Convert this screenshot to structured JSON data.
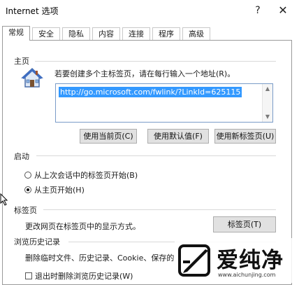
{
  "window": {
    "title": "Internet 选项",
    "help_glyph": "?",
    "close_glyph": "✕"
  },
  "tabs": [
    {
      "label": "常规",
      "active": true
    },
    {
      "label": "安全",
      "active": false
    },
    {
      "label": "隐私",
      "active": false
    },
    {
      "label": "内容",
      "active": false
    },
    {
      "label": "连接",
      "active": false
    },
    {
      "label": "程序",
      "active": false
    },
    {
      "label": "高级",
      "active": false
    }
  ],
  "homepage": {
    "group_label": "主页",
    "icon": "home-icon",
    "hint": "若要创建多个主标签页，请在每行输入一个地址(R)。",
    "url": "http://go.microsoft.com/fwlink/?LinkId=625115",
    "buttons": {
      "use_current": "使用当前页(C)",
      "use_default": "使用默认值(F)",
      "use_new_tab": "使用新标签页(U)"
    }
  },
  "startup": {
    "group_label": "启动",
    "options": [
      {
        "label": "从上次会话中的标签页开始(B)",
        "selected": false
      },
      {
        "label": "从主页开始(H)",
        "selected": true
      }
    ]
  },
  "tabs_section": {
    "group_label": "标签页",
    "description": "更改网页在标签页中的显示方式。",
    "button": "标签页(T)"
  },
  "history": {
    "group_label": "浏览历史记录",
    "description": "删除临时文件、历史记录、Cookie、保存的",
    "checkbox_label": "退出时删除浏览历史记录(W)",
    "checkbox_checked": false
  },
  "watermark": {
    "name": "爱纯净",
    "url": "www.aichunjing.com"
  },
  "colors": {
    "selection": "#3399ff",
    "border": "#9a9a9a"
  }
}
